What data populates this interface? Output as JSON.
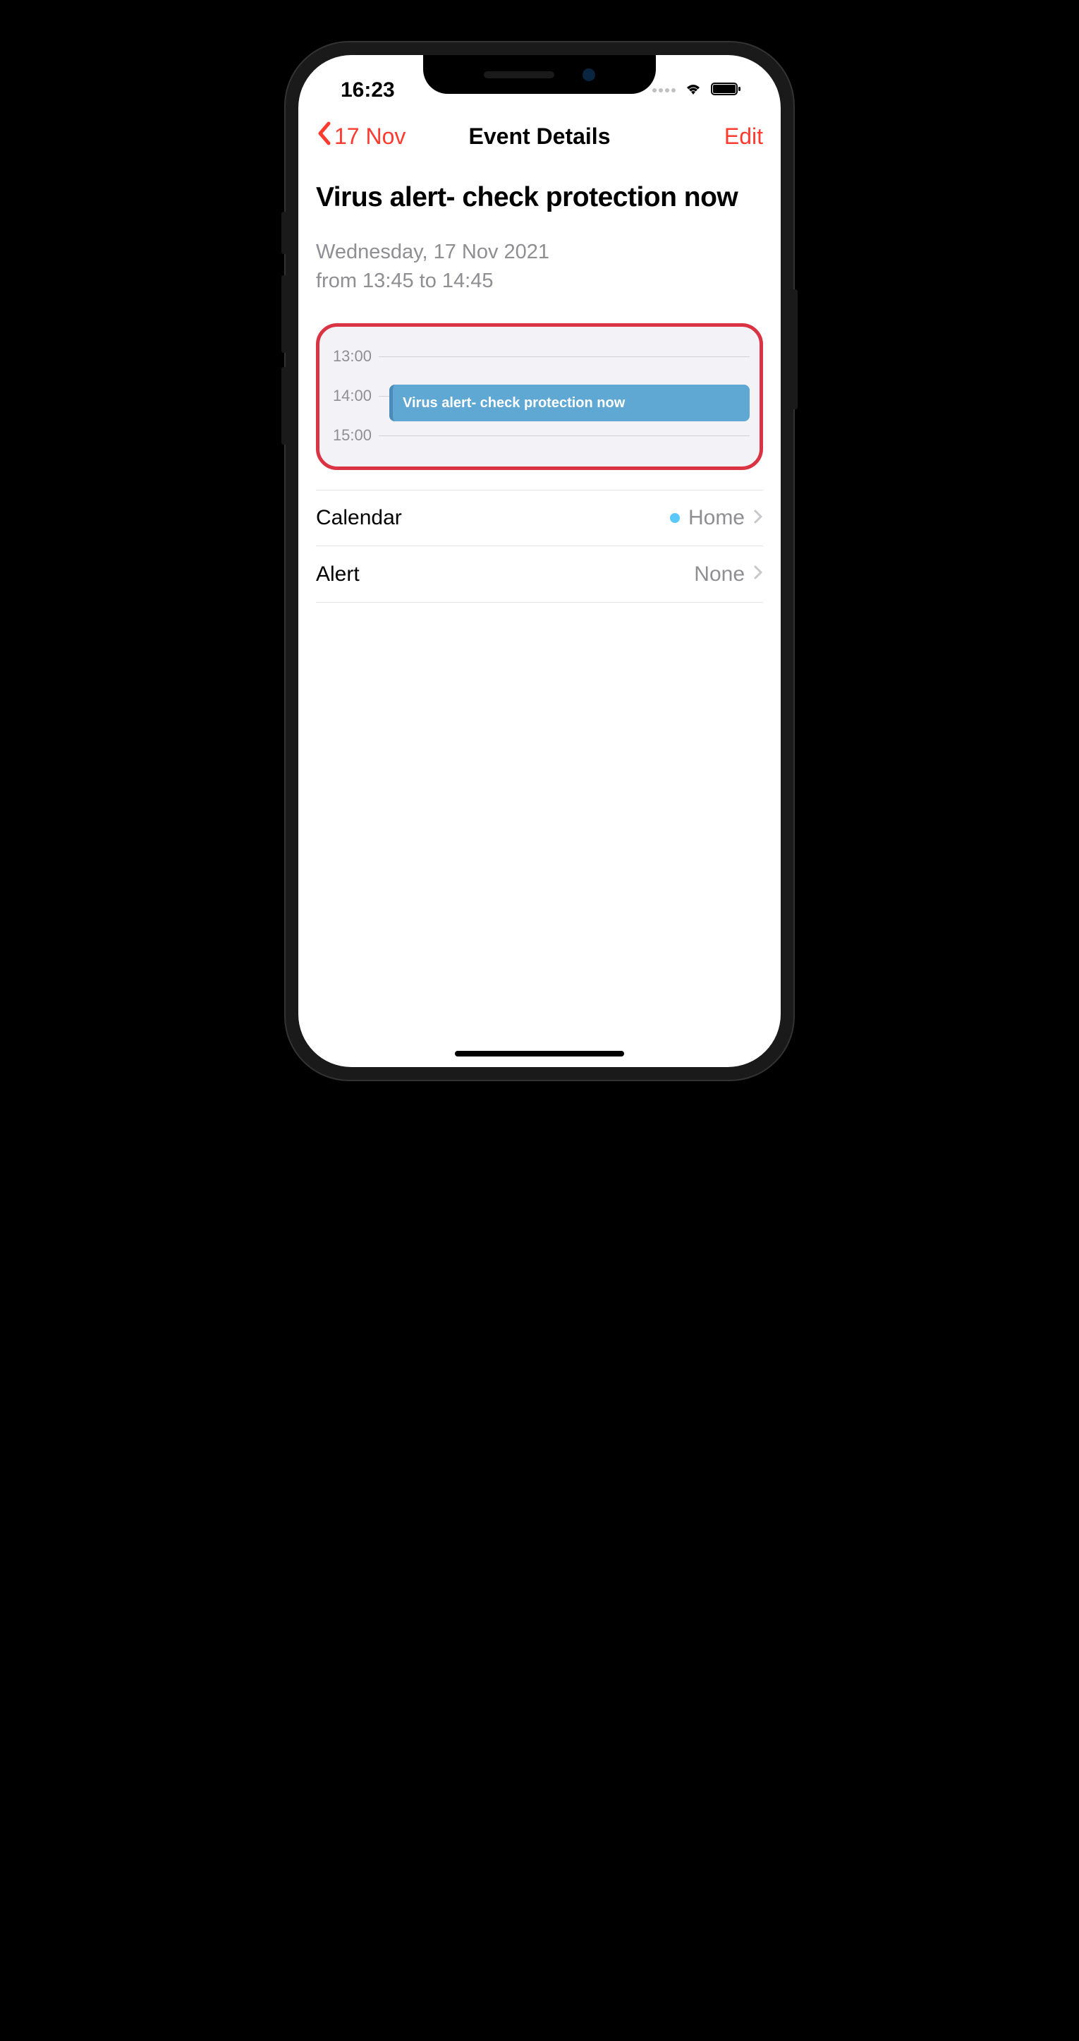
{
  "status": {
    "time": "16:23"
  },
  "nav": {
    "back_label": "17 Nov",
    "title": "Event Details",
    "edit_label": "Edit"
  },
  "event": {
    "title": "Virus alert- check protection now",
    "date_line1": "Wednesday, 17 Nov 2021",
    "date_line2": "from 13:45 to 14:45"
  },
  "timeline": {
    "hours": [
      "13:00",
      "14:00",
      "15:00"
    ],
    "block_text": "Virus alert- check protection now"
  },
  "rows": {
    "calendar_label": "Calendar",
    "calendar_value": "Home",
    "alert_label": "Alert",
    "alert_value": "None"
  }
}
